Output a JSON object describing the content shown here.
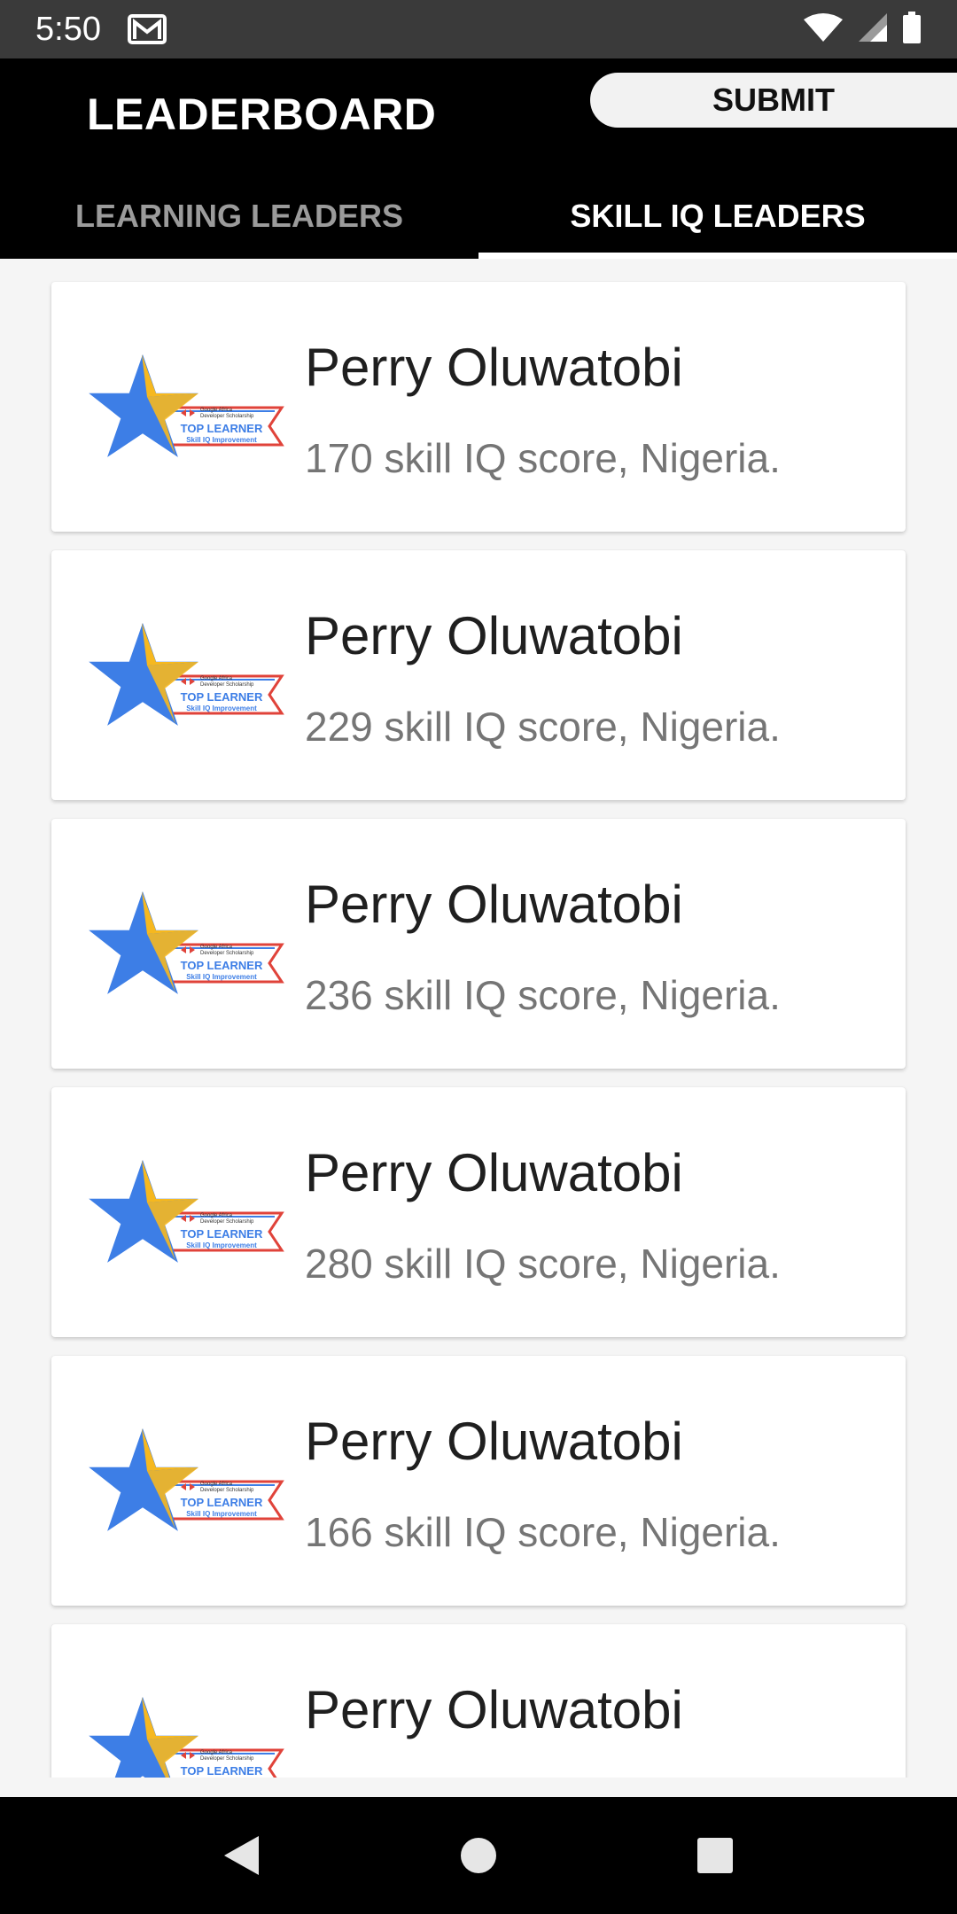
{
  "status_bar": {
    "time": "5:50",
    "icons": [
      "mail-icon",
      "wifi-icon",
      "signal-icon",
      "battery-icon"
    ]
  },
  "app_bar": {
    "title": "LEADERBOARD",
    "submit_label": "SUBMIT",
    "tabs": [
      {
        "label": "LEARNING LEADERS",
        "active": false
      },
      {
        "label": "SKILL IQ LEADERS",
        "active": true
      }
    ]
  },
  "badge": {
    "icon": "top-learner-badge-icon",
    "line1": "Google Africa",
    "line2": "Developer Scholarship",
    "line3": "TOP LEARNER",
    "line4": "Skill IQ Improvement"
  },
  "leaders": [
    {
      "name": "Perry Oluwatobi",
      "detail": "170 skill IQ score, Nigeria."
    },
    {
      "name": "Perry Oluwatobi",
      "detail": "229 skill IQ score, Nigeria."
    },
    {
      "name": "Perry Oluwatobi",
      "detail": "236 skill IQ score, Nigeria."
    },
    {
      "name": "Perry Oluwatobi",
      "detail": "280 skill IQ score, Nigeria."
    },
    {
      "name": "Perry Oluwatobi",
      "detail": "166 skill IQ score, Nigeria."
    },
    {
      "name": "Perry Oluwatobi",
      "detail": ""
    }
  ],
  "nav_bar": {
    "icons": [
      "back-icon",
      "home-icon",
      "recents-icon"
    ]
  },
  "colors": {
    "app_bar": "#000000",
    "status_bar": "#3a3a3a",
    "badge_blue": "#3d7ee6",
    "badge_gold": "#f6b81f",
    "badge_red": "#e0433a"
  }
}
